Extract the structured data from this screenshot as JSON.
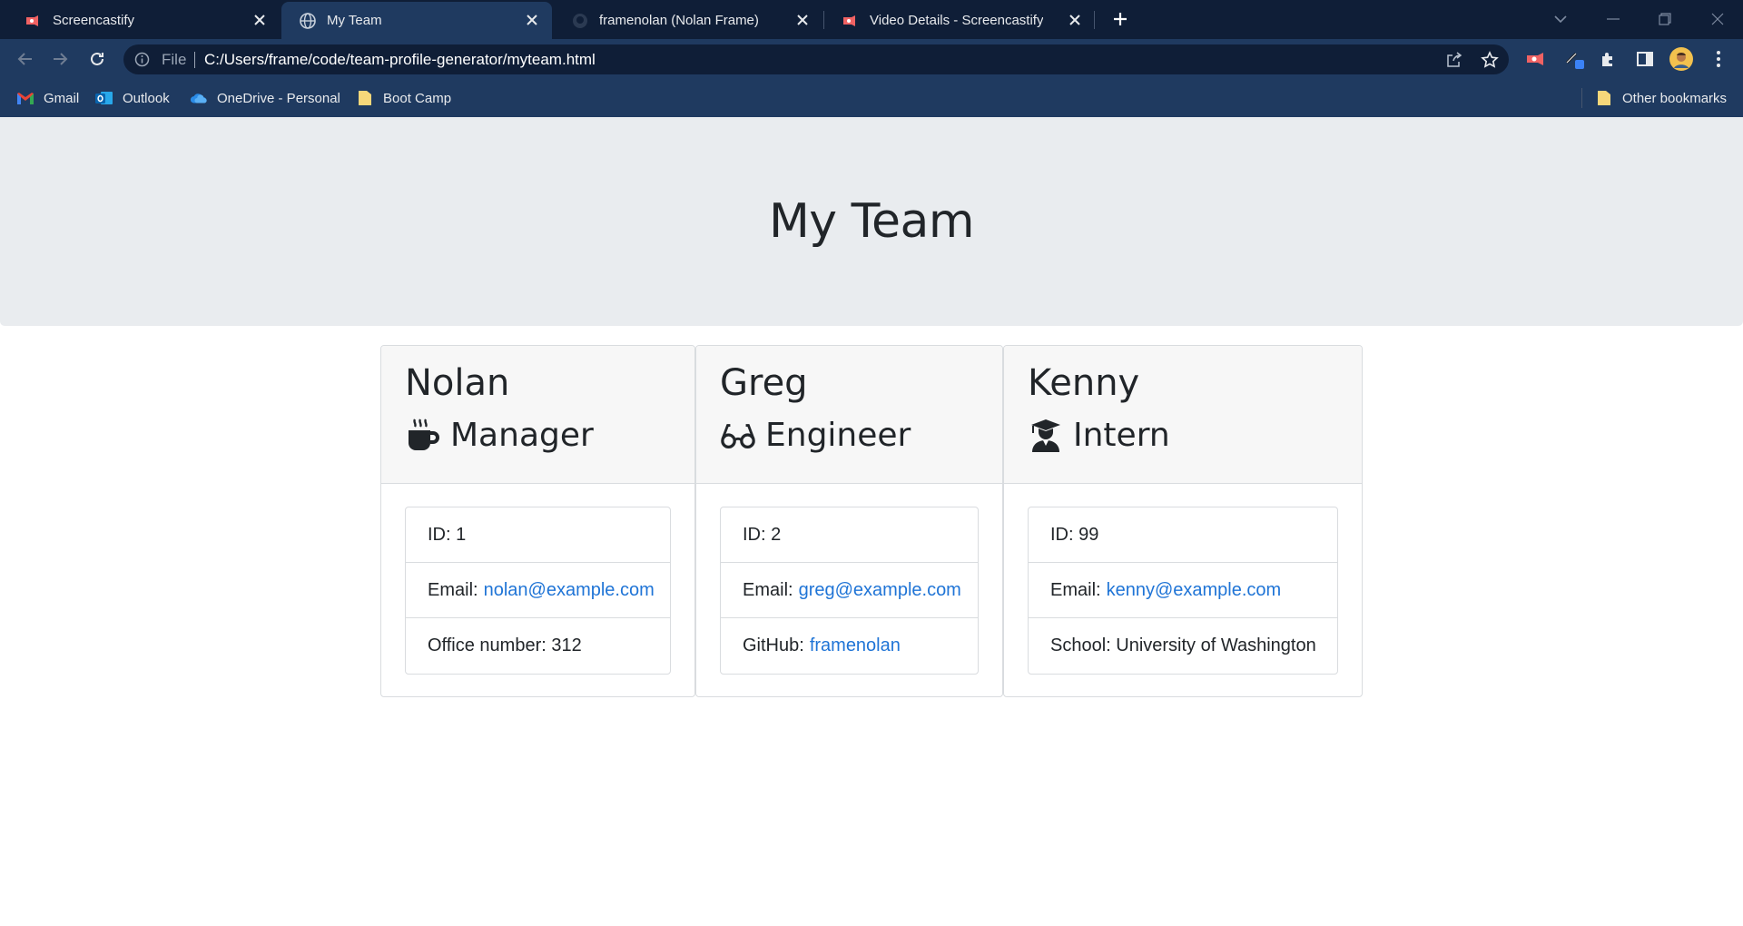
{
  "browser": {
    "tabs": [
      {
        "title": "Screencastify",
        "icon": "screencastify-icon",
        "active": false
      },
      {
        "title": "My Team",
        "icon": "globe-icon",
        "active": true
      },
      {
        "title": "framenolan (Nolan Frame)",
        "icon": "github-icon",
        "active": false
      },
      {
        "title": "Video Details - Screencastify",
        "icon": "screencastify-icon",
        "active": false
      }
    ],
    "address": {
      "scheme_label": "File",
      "url": "C:/Users/frame/code/team-profile-generator/myteam.html"
    },
    "bookmarks": [
      {
        "label": "Gmail",
        "icon": "gmail-icon"
      },
      {
        "label": "Outlook",
        "icon": "outlook-icon"
      },
      {
        "label": "OneDrive - Personal",
        "icon": "onedrive-icon"
      },
      {
        "label": "Boot Camp",
        "icon": "folder-icon"
      }
    ],
    "other_bookmarks": "Other bookmarks"
  },
  "page": {
    "title": "My Team",
    "members": [
      {
        "name": "Nolan",
        "role": "Manager",
        "role_icon": "mug-icon",
        "id_text": "ID: 1",
        "email_label": "Email:",
        "email": "nolan@example.com",
        "extra_label": "Office number: 312",
        "extra_link": ""
      },
      {
        "name": "Greg",
        "role": "Engineer",
        "role_icon": "glasses-icon",
        "id_text": "ID: 2",
        "email_label": "Email:",
        "email": "greg@example.com",
        "extra_label": "GitHub:",
        "extra_link": "framenolan"
      },
      {
        "name": "Kenny",
        "role": "Intern",
        "role_icon": "graduate-icon",
        "id_text": "ID: 99",
        "email_label": "Email:",
        "email": "kenny@example.com",
        "extra_label": "School: University of Washington",
        "extra_link": ""
      }
    ]
  },
  "colors": {
    "tabbar": "#0f1e37",
    "toolbar": "#1f3a60",
    "jumbotron": "#e9ecef",
    "link": "#1f74d6"
  }
}
